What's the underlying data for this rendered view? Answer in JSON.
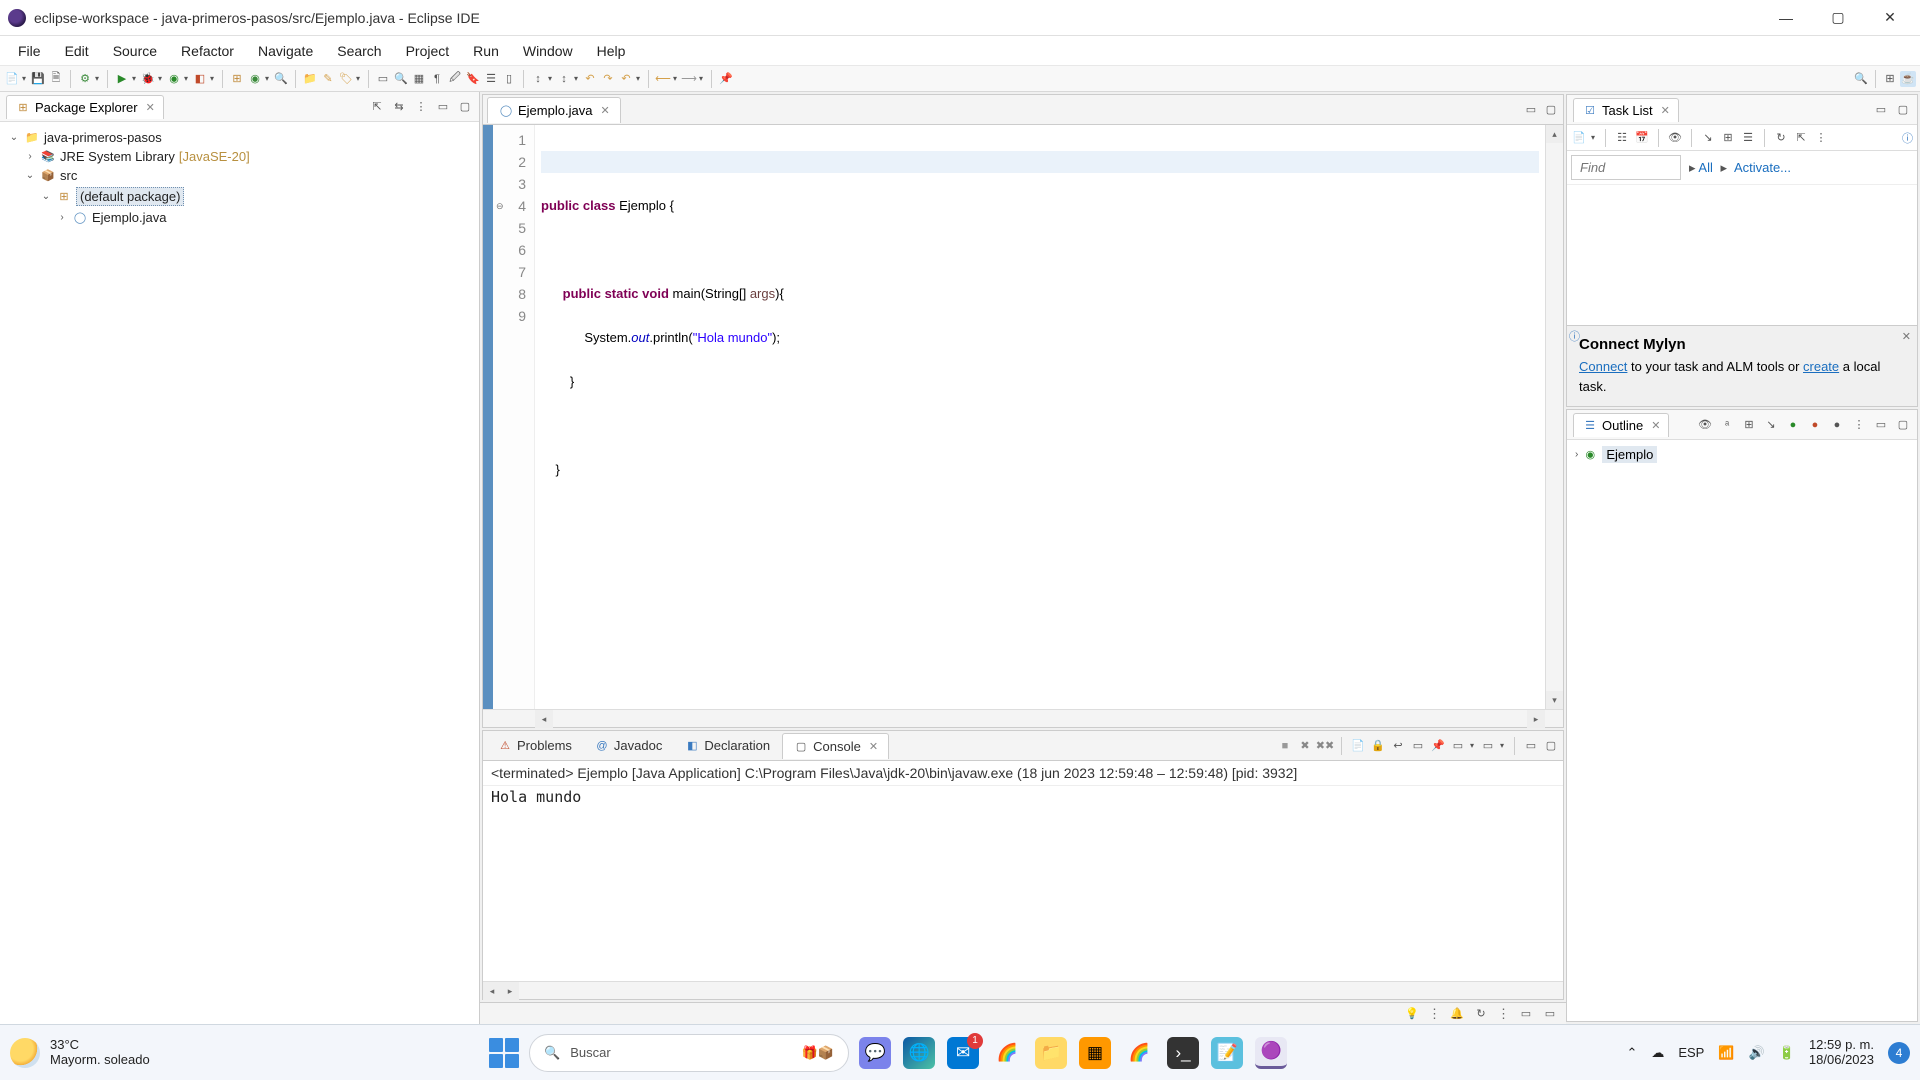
{
  "window": {
    "title": "eclipse-workspace - java-primeros-pasos/src/Ejemplo.java - Eclipse IDE"
  },
  "menu": [
    "File",
    "Edit",
    "Source",
    "Refactor",
    "Navigate",
    "Search",
    "Project",
    "Run",
    "Window",
    "Help"
  ],
  "package_explorer": {
    "title": "Package Explorer",
    "project": "java-primeros-pasos",
    "jre": "JRE System Library",
    "jre_ver": "[JavaSE-20]",
    "src": "src",
    "pkg": "(default package)",
    "file": "Ejemplo.java"
  },
  "editor": {
    "tab": "Ejemplo.java",
    "lines": {
      "l1": "",
      "l2_a": "public",
      "l2_b": "class",
      "l2_c": " Ejemplo {",
      "l3": "",
      "l4_a": "public",
      "l4_b": "static",
      "l4_c": "void",
      "l4_d": " main(String[] ",
      "l4_e": "args",
      "l4_f": "){",
      "l5_a": "            System.",
      "l5_b": "out",
      "l5_c": ".println(",
      "l5_d": "\"Hola mundo\"",
      "l5_e": ");",
      "l6": "        }",
      "l7": "",
      "l8": "    }",
      "l9": ""
    }
  },
  "console": {
    "tabs": {
      "problems": "Problems",
      "javadoc": "Javadoc",
      "declaration": "Declaration",
      "console": "Console"
    },
    "info": "<terminated> Ejemplo [Java Application] C:\\Program Files\\Java\\jdk-20\\bin\\javaw.exe  (18 jun 2023 12:59:48 – 12:59:48) [pid: 3932]",
    "output": "Hola mundo"
  },
  "tasklist": {
    "title": "Task List",
    "find_placeholder": "Find",
    "all": "All",
    "activate": "Activate..."
  },
  "mylyn": {
    "title": "Connect Mylyn",
    "connect": "Connect",
    "text1": " to your task and ALM tools or ",
    "create": "create",
    "text2": " a local task."
  },
  "outline": {
    "title": "Outline",
    "item": "Ejemplo"
  },
  "taskbar": {
    "temp": "33°C",
    "forecast": "Mayorm. soleado",
    "search": "Buscar",
    "lang": "ESP",
    "time": "12:59 p. m.",
    "date": "18/06/2023",
    "notif": "4"
  }
}
